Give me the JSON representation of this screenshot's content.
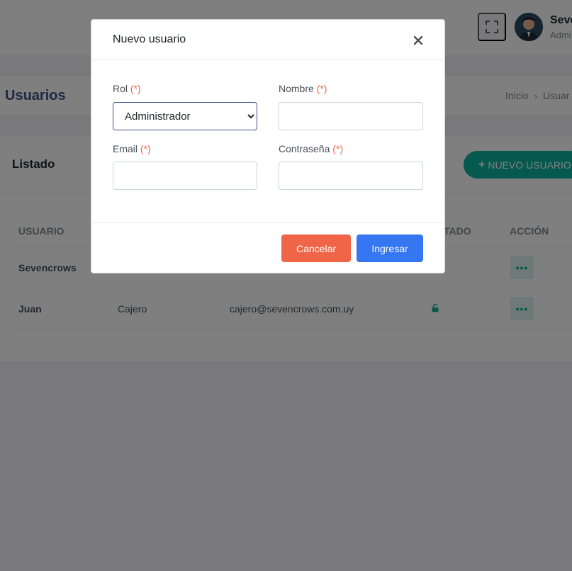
{
  "header": {
    "user_name": "Seve",
    "user_role": "Admi",
    "icons": {
      "fullscreen": "fullscreen-icon",
      "avatar": "user-avatar"
    }
  },
  "page": {
    "title": "Usuarios",
    "breadcrumb": [
      "Inicio",
      "Usuar"
    ]
  },
  "list": {
    "title": "Listado",
    "new_user_label": "NUEVO USUARIO",
    "columns": [
      "USUARIO",
      "TADO",
      "ACCIÓN"
    ],
    "rows": [
      {
        "usuario": "Sevencrows",
        "rol": "",
        "email": ""
      },
      {
        "usuario": "Juan",
        "rol": "Cajero",
        "email": "cajero@sevencrows.com.uy"
      }
    ]
  },
  "modal": {
    "title": "Nuevo usuario",
    "required_mark": "(*)",
    "rol_label": "Rol",
    "rol_value": "Administrador",
    "nombre_label": "Nombre",
    "email_label": "Email",
    "password_label": "Contraseña",
    "cancel_label": "Cancelar",
    "submit_label": "Ingresar"
  },
  "colors": {
    "primary": "#405189",
    "success": "#0ab39c",
    "danger": "#f06548",
    "info": "#3577f1"
  }
}
